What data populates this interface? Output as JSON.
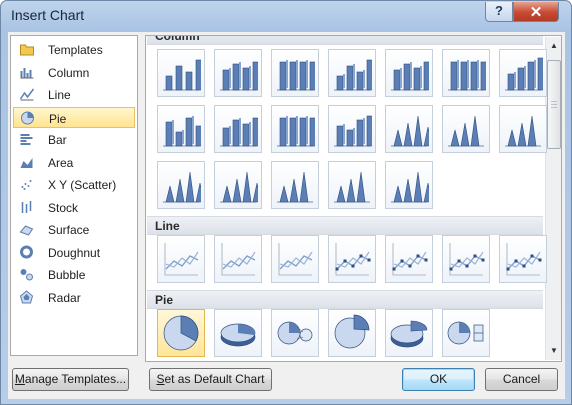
{
  "window": {
    "title": "Insert Chart"
  },
  "titlebar": {
    "help_glyph": "?",
    "close_glyph": "✕"
  },
  "chart_types": [
    {
      "label": "Templates",
      "icon": "folder-icon"
    },
    {
      "label": "Column",
      "icon": "column-chart-icon"
    },
    {
      "label": "Line",
      "icon": "line-chart-icon"
    },
    {
      "label": "Pie",
      "icon": "pie-chart-icon",
      "selected": true
    },
    {
      "label": "Bar",
      "icon": "bar-chart-icon"
    },
    {
      "label": "Area",
      "icon": "area-chart-icon"
    },
    {
      "label": "X Y (Scatter)",
      "icon": "scatter-chart-icon"
    },
    {
      "label": "Stock",
      "icon": "stock-chart-icon"
    },
    {
      "label": "Surface",
      "icon": "surface-chart-icon"
    },
    {
      "label": "Doughnut",
      "icon": "doughnut-chart-icon"
    },
    {
      "label": "Bubble",
      "icon": "bubble-chart-icon"
    },
    {
      "label": "Radar",
      "icon": "radar-chart-icon"
    }
  ],
  "gallery": {
    "sections": [
      {
        "title": "Column",
        "subtypes": 19
      },
      {
        "title": "Line",
        "subtypes": 7
      },
      {
        "title": "Pie",
        "subtypes": 6,
        "selected_index": 0
      }
    ]
  },
  "buttons": {
    "manage_templates": {
      "mnemonic": "M",
      "rest": "anage Templates..."
    },
    "set_default": {
      "mnemonic": "S",
      "rest": "et as Default Chart"
    },
    "ok": "OK",
    "cancel": "Cancel"
  },
  "colors": {
    "selection_fill": "#ffe48f",
    "chart_blue": "#5b7fb4",
    "chart_light": "#c9d8ee",
    "close_red": "#c74a34"
  }
}
